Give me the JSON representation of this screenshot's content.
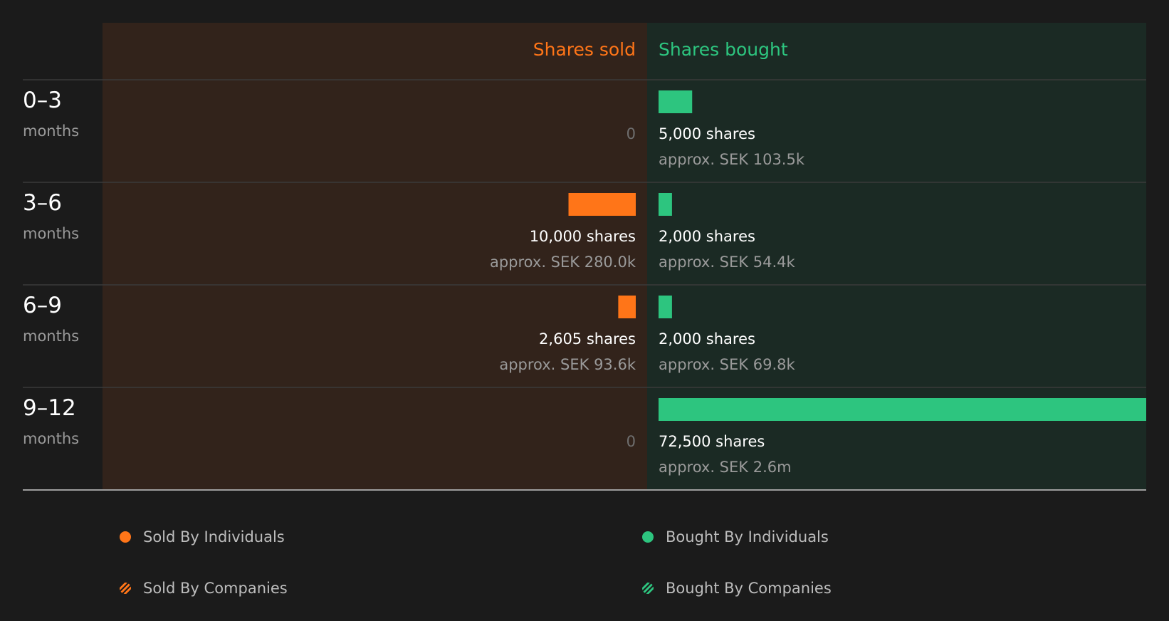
{
  "colors": {
    "sold": "#ff7518",
    "bought": "#2dc57f",
    "sold_panel": "#32231b",
    "bought_panel": "#1b2a24",
    "background": "#1b1b1b"
  },
  "chart_data": {
    "type": "bar",
    "orientation": "horizontal-diverging",
    "headers": {
      "sold": "Shares sold",
      "bought": "Shares bought"
    },
    "categories": [
      {
        "label": "0–3",
        "unit": "months"
      },
      {
        "label": "3–6",
        "unit": "months"
      },
      {
        "label": "6–9",
        "unit": "months"
      },
      {
        "label": "9–12",
        "unit": "months"
      }
    ],
    "series": [
      {
        "name": "Shares sold",
        "values": [
          0,
          10000,
          2605,
          0
        ],
        "value_labels": [
          "0",
          "10,000 shares",
          "2,605 shares",
          "0"
        ],
        "approx_labels": [
          "",
          "approx. SEK 280.0k",
          "approx. SEK 93.6k",
          ""
        ]
      },
      {
        "name": "Shares bought",
        "values": [
          5000,
          2000,
          2000,
          72500
        ],
        "value_labels": [
          "5,000 shares",
          "2,000 shares",
          "2,000 shares",
          "72,500 shares"
        ],
        "approx_labels": [
          "approx. SEK 103.5k",
          "approx. SEK 54.4k",
          "approx. SEK 69.8k",
          "approx. SEK 2.6m"
        ]
      }
    ],
    "xmax": 72500
  },
  "legend": [
    {
      "label": "Sold By Individuals",
      "style": "dot",
      "color": "#ff7518"
    },
    {
      "label": "Bought By Individuals",
      "style": "dot",
      "color": "#2dc57f"
    },
    {
      "label": "Sold By Companies",
      "style": "hatch",
      "color": "#ff7518"
    },
    {
      "label": "Bought By Companies",
      "style": "hatch",
      "color": "#2dc57f"
    }
  ]
}
